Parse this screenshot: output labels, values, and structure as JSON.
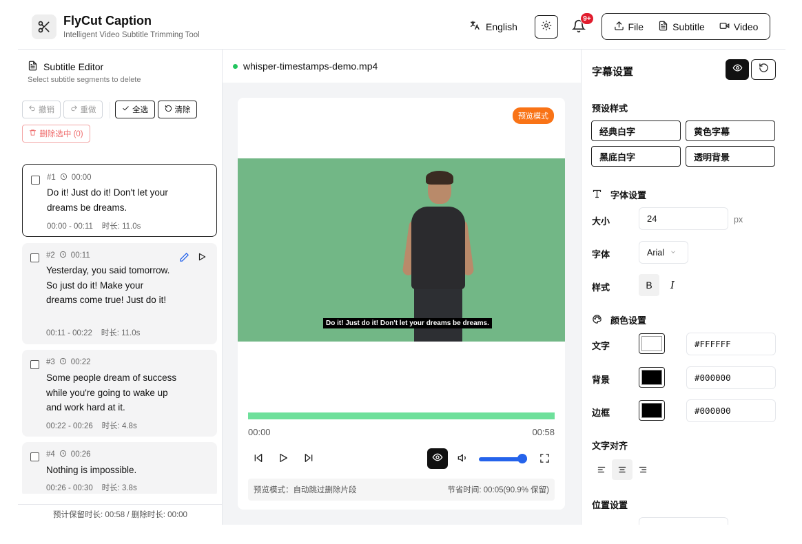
{
  "header": {
    "title": "FlyCut Caption",
    "subtitle": "Intelligent Video Subtitle Trimming Tool",
    "language": "English",
    "notification_badge": "9+",
    "nav": {
      "file": "File",
      "subtitle": "Subtitle",
      "video": "Video"
    }
  },
  "subtitle_editor": {
    "title": "Subtitle Editor",
    "hint": "Select subtitle segments to delete",
    "undo": "撤销",
    "redo": "重做",
    "select_all": "全选",
    "clear": "清除",
    "delete_selected": "删除选中 (0)",
    "segments": [
      {
        "id": "#1",
        "start": "00:00",
        "text": "Do it! Just do it! Don't let your dreams be dreams.",
        "range": "00:00 - 00:11",
        "duration": "时长: 11.0s"
      },
      {
        "id": "#2",
        "start": "00:11",
        "text": "Yesterday, you said tomorrow. So just do it! Make your dreams come true! Just do it!",
        "range": "00:11 - 00:22",
        "duration": "时长: 11.0s"
      },
      {
        "id": "#3",
        "start": "00:22",
        "text": "Some people dream of success while you're going to wake up and work hard at it.",
        "range": "00:22 - 00:26",
        "duration": "时长: 4.8s"
      },
      {
        "id": "#4",
        "start": "00:26",
        "text": "Nothing is impossible.",
        "range": "00:26 - 00:30",
        "duration": "时长: 3.8s"
      }
    ],
    "footer": "预计保留时长: 00:58 / 删除时长: 00:00"
  },
  "player": {
    "filename": "whisper-timestamps-demo.mp4",
    "preview_badge": "预览模式",
    "caption": "Do it! Just do it! Don't let your dreams be dreams.",
    "progress_fraction": 1.0,
    "current_time": "00:00",
    "total_time": "00:58",
    "volume_fraction": 0.95,
    "status_left": "预览模式：自动跳过删除片段",
    "status_right": "节省时间: 00:05(90.9% 保留)"
  },
  "subtitle_settings": {
    "title": "字幕设置",
    "presets_label": "预设样式",
    "presets": [
      "经典白字",
      "黄色字幕",
      "黑底白字",
      "透明背景"
    ],
    "font_section": "字体设置",
    "size_label": "大小",
    "size_value": "24",
    "size_unit": "px",
    "font_label": "字体",
    "font_value": "Arial",
    "style_label": "样式",
    "bold": "B",
    "italic": "I",
    "color_section": "颜色设置",
    "text_color_label": "文字",
    "text_color": "#FFFFFF",
    "bg_color_label": "背景",
    "bg_color": "#000000",
    "border_color_label": "边框",
    "border_color": "#000000",
    "align_label": "文字对齐",
    "position_label": "位置设置"
  },
  "colors": {
    "accent_orange": "#f97316",
    "progress_green": "#6ee09b",
    "volume_blue": "#2563eb",
    "danger_red": "#ef6b6b",
    "badge_red": "#e11d2e"
  }
}
